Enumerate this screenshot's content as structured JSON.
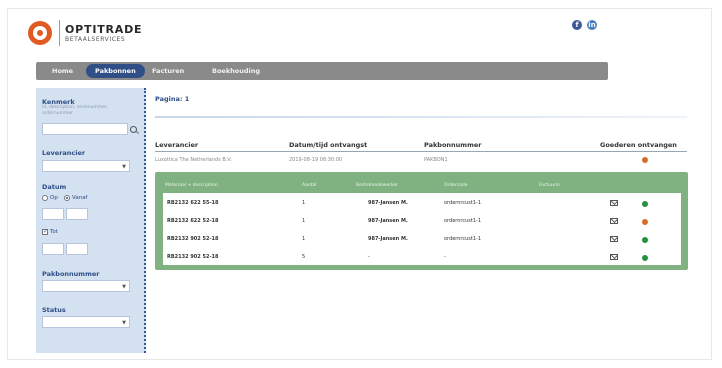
{
  "brand": {
    "name": "OPTITRADE",
    "sub": "BETAALSERVICES"
  },
  "social": {
    "facebook_glyph": "f",
    "linkedin_glyph": "in"
  },
  "nav": [
    {
      "label": "Home"
    },
    {
      "label": "Pakbonnen",
      "active": true
    },
    {
      "label": "Facturen"
    },
    {
      "label": "Boekhouding"
    }
  ],
  "sidebar": {
    "kenmerk_label": "Kenmerk",
    "kenmerk_hint": "id, description, serienummer, ordernummer",
    "kenmerk_value": "",
    "leverancier_label": "Leverancier",
    "leverancier_value": "",
    "datum_label": "Datum",
    "radio_op": "Op",
    "radio_vanaf": "Vanaf",
    "tot_label": "Tot",
    "pakbonnummer_label": "Pakbonnummer",
    "pakbonnummer_value": "",
    "status_label": "Status",
    "status_value": ""
  },
  "main": {
    "page_label": "Pagina:",
    "page_number": "1",
    "columns": {
      "leverancier": "Leverancier",
      "datum": "Datum/tijd ontvangst",
      "pakbonnummer": "Pakbonnummer",
      "goederen": "Goederen ontvangen"
    },
    "record": {
      "leverancier": "Luxottica The Netherlands B.V.",
      "datum": "2019-08-19 08:30:00",
      "pakbonnummer": "PAKBON1",
      "status_color": "#d86a2a"
    },
    "detail_headers": [
      "Materiaal + description",
      "Aantal",
      "Bestelmedewerker",
      "Ordercode",
      "Factuurnr"
    ],
    "detail_rows": [
      {
        "material": "RB2132 622 55-18",
        "aantal": "1",
        "medewerker": "987-Jansen M.",
        "order": "ordernrcust1-1",
        "status_color": "#22923c"
      },
      {
        "material": "RB2132 622 52-18",
        "aantal": "1",
        "medewerker": "987-Jansen M.",
        "order": "ordernrcust1-1",
        "status_color": "#d86a2a"
      },
      {
        "material": "RB2132 902 52-18",
        "aantal": "1",
        "medewerker": "987-Jansen M.",
        "order": "ordernrcust1-1",
        "status_color": "#22923c"
      },
      {
        "material": "RB2132 902 52-18",
        "aantal": "5",
        "medewerker": "-",
        "order": "-",
        "status_color": "#22923c"
      }
    ]
  }
}
